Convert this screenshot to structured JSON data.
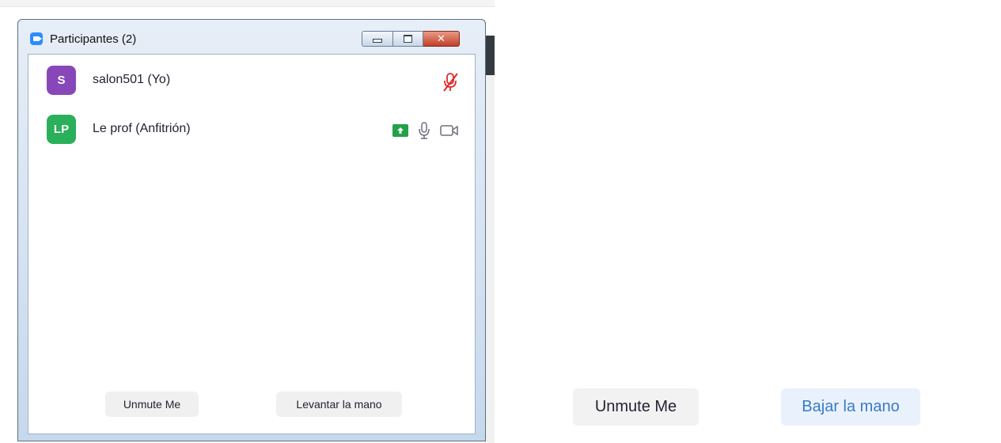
{
  "window": {
    "title": "Participantes (2)",
    "controls": {
      "minimize_icon": "minimize-icon",
      "maximize_icon": "maximize-icon",
      "close_icon": "close-icon",
      "close_glyph": "✕"
    }
  },
  "participants": [
    {
      "initials": "S",
      "name": "salon501 (Yo)",
      "avatar_color": "#8847b9",
      "icons": [
        "muted-mic-icon"
      ]
    },
    {
      "initials": "LP",
      "name": "Le prof (Anfitrión)",
      "avatar_color": "#2ab05a",
      "icons": [
        "share-screen-icon",
        "microphone-icon",
        "video-camera-icon"
      ]
    }
  ],
  "panel_buttons": {
    "unmute": "Unmute Me",
    "raise_hand": "Levantar la mano"
  },
  "outer_buttons": {
    "unmute": "Unmute Me",
    "lower_hand": "Bajar la mano"
  },
  "colors": {
    "accent": "#2d8cff",
    "share_green": "#24a148",
    "muted_red": "#e02828",
    "lower_hand_text": "#3a79c8"
  }
}
